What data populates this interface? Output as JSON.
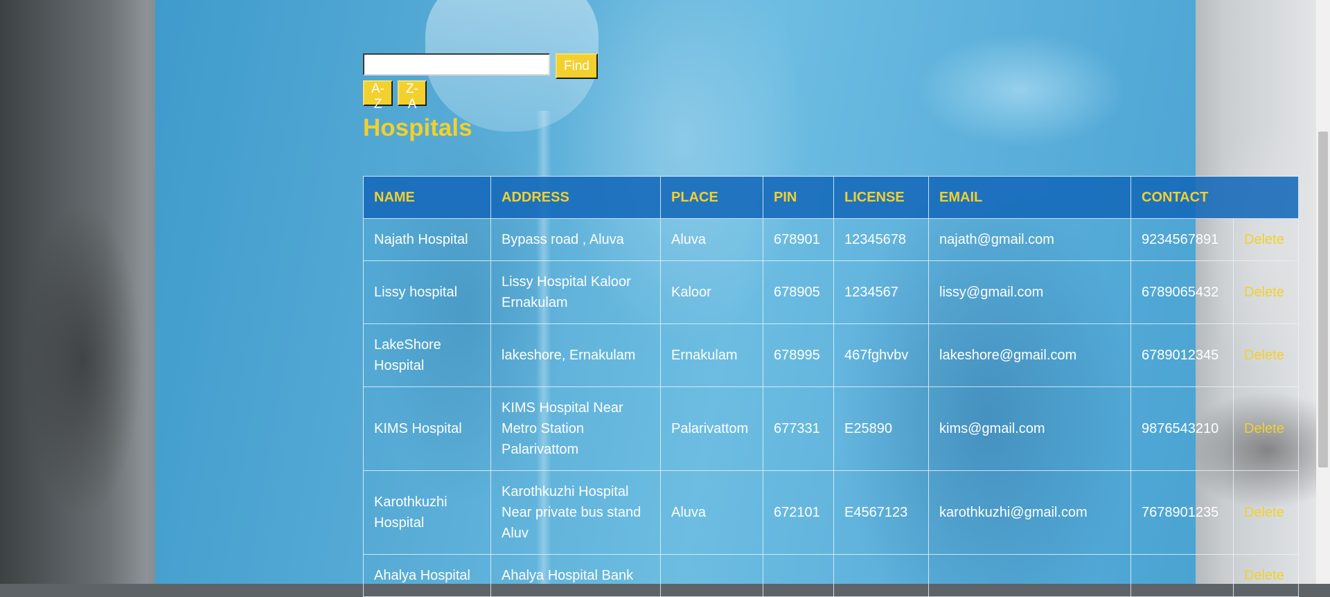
{
  "search": {
    "value": "",
    "placeholder": "",
    "find_label": "Find"
  },
  "sort": {
    "az_label": "A-Z",
    "za_label": "Z-A"
  },
  "page_title": "Hospitals",
  "table": {
    "headers": [
      "NAME",
      "ADDRESS",
      "PLACE",
      "PIN",
      "LICENSE",
      "EMAIL",
      "CONTACT"
    ],
    "delete_label": "Delete",
    "rows": [
      {
        "name": "Najath Hospital",
        "address": "Bypass road , Aluva",
        "place": "Aluva",
        "pin": "678901",
        "license": "12345678",
        "email": "najath@gmail.com",
        "contact": "9234567891"
      },
      {
        "name": "Lissy hospital",
        "address": "Lissy Hospital Kaloor Ernakulam",
        "place": "Kaloor",
        "pin": "678905",
        "license": "1234567",
        "email": "lissy@gmail.com",
        "contact": "6789065432"
      },
      {
        "name": "LakeShore Hospital",
        "address": "lakeshore, Ernakulam",
        "place": "Ernakulam",
        "pin": "678995",
        "license": "467fghvbv",
        "email": "lakeshore@gmail.com",
        "contact": "6789012345"
      },
      {
        "name": "KIMS Hospital",
        "address": "KIMS Hospital Near Metro Station Palarivattom",
        "place": "Palarivattom",
        "pin": "677331",
        "license": "E25890",
        "email": "kims@gmail.com",
        "contact": "9876543210"
      },
      {
        "name": "Karothkuzhi Hospital",
        "address": "Karothkuzhi Hospital Near private bus stand Aluv",
        "place": "Aluva",
        "pin": "672101",
        "license": "E4567123",
        "email": "karothkuzhi@gmail.com",
        "contact": "7678901235"
      },
      {
        "name": "Ahalya Hospital",
        "address": "Ahalya Hospital Bank",
        "place": "",
        "pin": "",
        "license": "",
        "email": "",
        "contact": ""
      }
    ]
  }
}
